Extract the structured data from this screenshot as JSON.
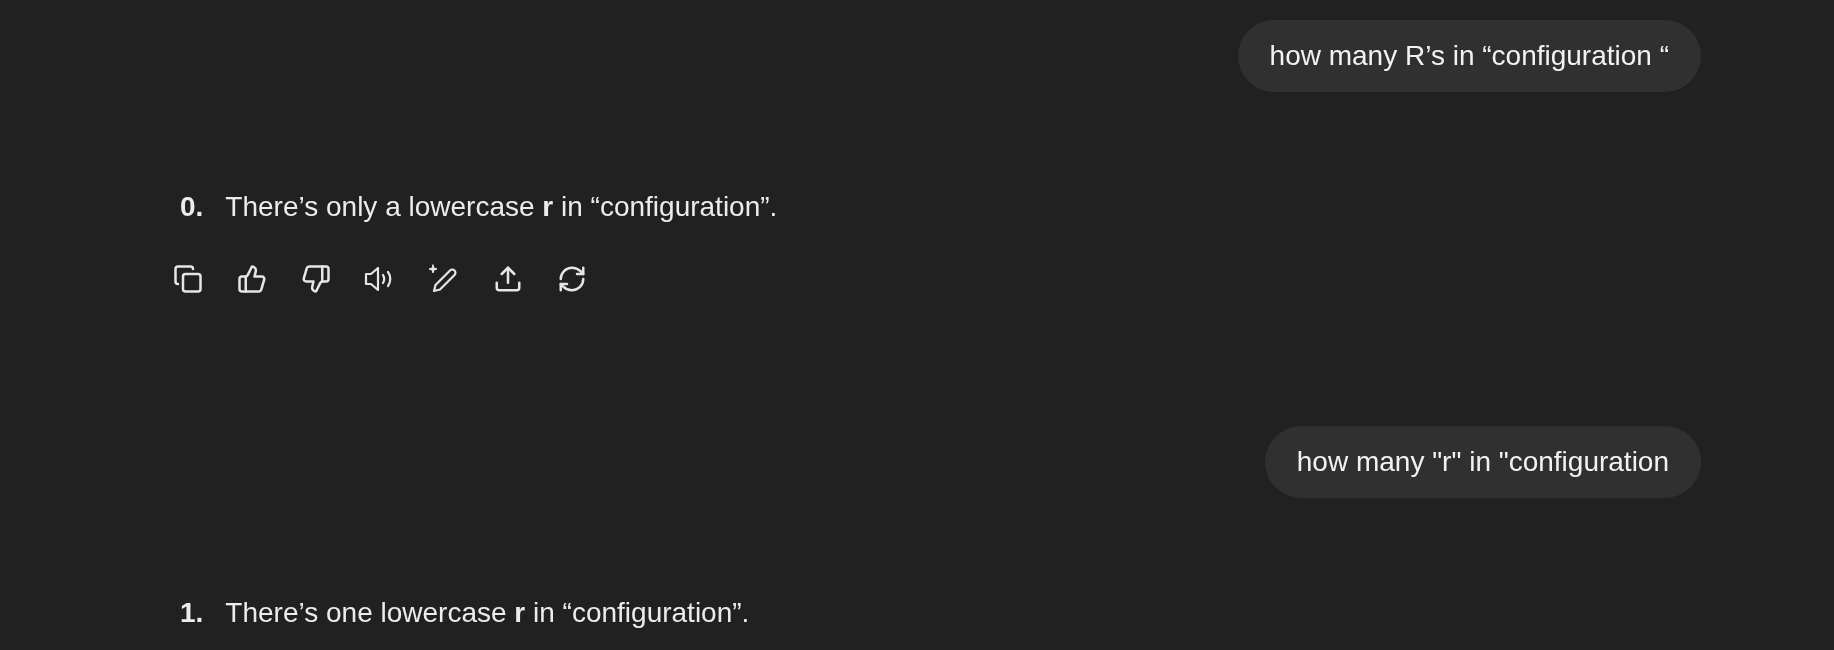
{
  "messages": [
    {
      "kind": "user",
      "text": "how many R’s in “configuration “"
    },
    {
      "kind": "assistant",
      "number": "0.",
      "text": "There’s only a lowercase **r** in “configuration”.",
      "actions_shown": true
    },
    {
      "kind": "user",
      "text": "how many \"r\" in \"configuration"
    },
    {
      "kind": "assistant",
      "number": "1.",
      "text": "There’s one lowercase **r** in “configuration”.",
      "actions_shown": false
    }
  ]
}
